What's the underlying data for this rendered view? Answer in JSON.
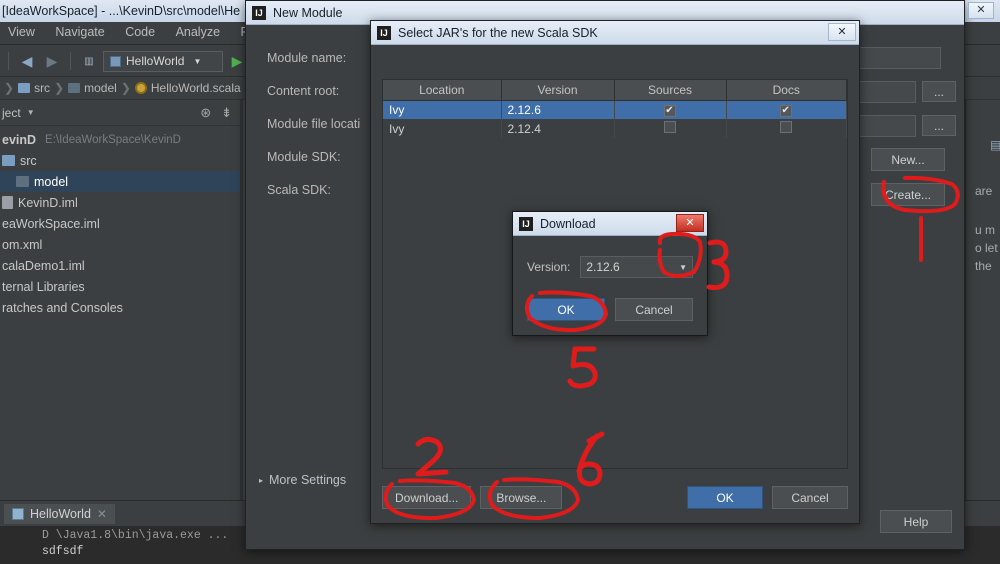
{
  "ide": {
    "title": "[IdeaWorkSpace] - ...\\KevinD\\src\\model\\He",
    "window_buttons": {
      "close": "✕"
    },
    "menus": [
      "View",
      "Navigate",
      "Code",
      "Analyze",
      "Refacto"
    ],
    "toolbar": {
      "back_icon": "arrow-left-icon",
      "forward_icon": "arrow-right-icon",
      "run_config": "HelloWorld",
      "run_icon": "run-play-icon"
    },
    "breadcrumb": [
      "src",
      "model",
      "HelloWorld.scala"
    ],
    "project_panel": {
      "title": "ject",
      "icons": [
        "target-icon",
        "collapse-all-icon"
      ],
      "items": [
        {
          "label": "evinD",
          "path": "E:\\IdeaWorkSpace\\KevinD",
          "icon": "project-icon",
          "selected": false
        },
        {
          "label": "src",
          "icon": "folder-source-icon",
          "selected": false
        },
        {
          "label": "model",
          "icon": "folder-icon",
          "selected": true
        },
        {
          "label": "KevinD.iml",
          "icon": "file-icon",
          "selected": false
        },
        {
          "label": "eaWorkSpace.iml",
          "icon": "file-icon",
          "selected": false
        },
        {
          "label": "om.xml",
          "icon": "file-icon",
          "selected": false
        },
        {
          "label": "calaDemo1.iml",
          "icon": "file-icon",
          "selected": false
        },
        {
          "label": "ternal Libraries",
          "icon": "library-icon",
          "selected": false
        },
        {
          "label": "ratches and Consoles",
          "icon": "scratches-icon",
          "selected": false
        }
      ]
    },
    "run_panel": {
      "tab": "HelloWorld",
      "close_icon": "close-icon",
      "console_lines": [
        "D \\Java1.8\\bin\\java.exe ...",
        "sdfsdf"
      ]
    }
  },
  "new_module_dialog": {
    "title": "New Module",
    "icon": "intellij-logo-icon",
    "close_label": "✕",
    "labels": [
      "Module name:",
      "Content root:",
      "Module file locati",
      "Module SDK:",
      "Scala SDK:"
    ],
    "buttons": {
      "browse_dots_1": "...",
      "browse_dots_2": "...",
      "new": "New...",
      "create": "Create...",
      "help": "Help"
    },
    "more_settings": "More Settings",
    "more_settings_triangle": "▸",
    "side_text": [
      "are",
      "u m",
      "o let",
      "the"
    ]
  },
  "select_jars_dialog": {
    "title": "Select JAR's for the new Scala SDK",
    "icon": "intellij-logo-icon",
    "close_label": "✕",
    "table": {
      "columns": [
        "Location",
        "Version",
        "Sources",
        "Docs"
      ],
      "rows": [
        {
          "location": "Ivy",
          "version": "2.12.6",
          "sources": true,
          "docs": true,
          "selected": true
        },
        {
          "location": "Ivy",
          "version": "2.12.4",
          "sources": false,
          "docs": false,
          "selected": false
        }
      ],
      "check_glyph": "✔"
    },
    "buttons": {
      "download": "Download...",
      "browse": "Browse...",
      "ok": "OK",
      "cancel": "Cancel"
    }
  },
  "download_dialog": {
    "title": "Download",
    "icon": "intellij-logo-icon",
    "close_label": "✕",
    "version_label": "Version:",
    "version_value": "2.12.6",
    "dropdown_arrow": "▼",
    "buttons": {
      "ok": "OK",
      "cancel": "Cancel"
    }
  },
  "annotations": {
    "color": "#e01b1b",
    "marks": [
      {
        "text": "1",
        "kind": "line-pointer",
        "target": "create-button"
      },
      {
        "text": "2",
        "kind": "digit",
        "target": "download-button"
      },
      {
        "text": "3",
        "kind": "digit",
        "target": "version-dropdown"
      },
      {
        "text": "5",
        "kind": "digit",
        "target": "download-ok-button"
      },
      {
        "text": "6",
        "kind": "digit",
        "target": "browse-button"
      }
    ]
  }
}
